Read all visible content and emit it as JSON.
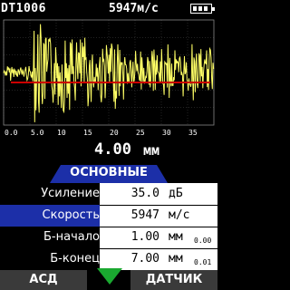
{
  "status": {
    "device": "DT1006",
    "speed": "5947м/с",
    "battery_cells": 3
  },
  "scope": {
    "x_ticks": [
      "0.0",
      "5.0",
      "10",
      "15",
      "20",
      "25",
      "30",
      "35"
    ],
    "trace_color": "#ffff66",
    "gate_color": "#cc0000"
  },
  "thickness": {
    "value": "4.00",
    "unit": "мм"
  },
  "tab": {
    "label": "ОСНОВНЫЕ",
    "color": "#1c2fa8"
  },
  "params": [
    {
      "label": "Усиление",
      "value": "35.0",
      "unit": "дБ",
      "extra": "",
      "selected": false
    },
    {
      "label": "Скорость",
      "value": "5947",
      "unit": "м/с",
      "extra": "",
      "selected": true
    },
    {
      "label": "Б-начало",
      "value": "1.00",
      "unit": "мм",
      "extra": "0.00",
      "selected": false
    },
    {
      "label": "Б-конец",
      "value": "7.00",
      "unit": "мм",
      "extra": "0.01",
      "selected": false
    }
  ],
  "softkeys": {
    "left": "АСД",
    "right": "ДАТЧИК",
    "center_icon": "down-arrow-icon"
  }
}
